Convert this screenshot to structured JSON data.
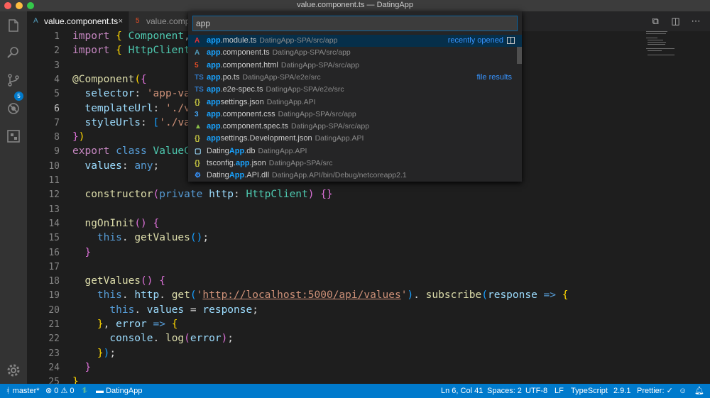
{
  "window": {
    "title": "value.component.ts — DatingApp"
  },
  "activity_bar": {
    "icons": [
      "files-icon",
      "search-icon",
      "source-control-icon",
      "debug-icon",
      "extensions-icon",
      "gear-icon"
    ],
    "scm_badge": "5"
  },
  "tabs": [
    {
      "label": "value.component.ts",
      "active": true,
      "icon": "angular-icon",
      "close": "×"
    },
    {
      "label": "value.compo",
      "active": false,
      "icon": "html-icon"
    }
  ],
  "quick_open": {
    "query": "app",
    "items": [
      {
        "match": "app",
        "rest": ".module.ts",
        "path": "DatingApp-SPA/src/app",
        "icon": "angular-red-icon",
        "tag": "recently opened"
      },
      {
        "match": "app",
        "rest": ".component.ts",
        "path": "DatingApp-SPA/src/app",
        "icon": "angular-blue-icon",
        "tag": ""
      },
      {
        "match": "app",
        "rest": ".component.html",
        "path": "DatingApp-SPA/src/app",
        "icon": "html-icon",
        "tag": ""
      },
      {
        "match": "app",
        "rest": ".po.ts",
        "path": "DatingApp-SPA/e2e/src",
        "icon": "ts-icon",
        "tag": "file results"
      },
      {
        "match": "app",
        "rest": ".e2e-spec.ts",
        "path": "DatingApp-SPA/e2e/src",
        "icon": "ts-icon",
        "tag": ""
      },
      {
        "match": "app",
        "rest": "settings.json",
        "path": "DatingApp.API",
        "icon": "json-icon",
        "tag": ""
      },
      {
        "match": "app",
        "rest": ".component.css",
        "path": "DatingApp-SPA/src/app",
        "icon": "css-icon",
        "tag": ""
      },
      {
        "match": "app",
        "rest": ".component.spec.ts",
        "path": "DatingApp-SPA/src/app",
        "icon": "spec-icon",
        "tag": ""
      },
      {
        "match": "app",
        "rest": "settings.Development.json",
        "path": "DatingApp.API",
        "icon": "json-icon",
        "tag": ""
      },
      {
        "pre": "Dating",
        "match": "App",
        "rest": ".db",
        "path": "DatingApp.API",
        "icon": "file-icon",
        "tag": ""
      },
      {
        "pre": "tsconfig.",
        "match": "app",
        "rest": ".json",
        "path": "DatingApp-SPA/src",
        "icon": "json-icon",
        "tag": ""
      },
      {
        "pre": "Dating",
        "match": "App",
        "rest": ".API.dll",
        "path": "DatingApp.API/bin/Debug/netcoreapp2.1",
        "icon": "gear-file-icon",
        "tag": ""
      }
    ]
  },
  "editor": {
    "line_numbers": [
      "1",
      "2",
      "3",
      "4",
      "5",
      "6",
      "7",
      "8",
      "9",
      "10",
      "11",
      "12",
      "13",
      "14",
      "15",
      "16",
      "17",
      "18",
      "19",
      "20",
      "21",
      "22",
      "23",
      "24",
      "25"
    ],
    "current_line": "6",
    "lines": [
      [
        [
          "kw",
          "import "
        ],
        [
          "br1",
          "{ "
        ],
        [
          "ty",
          "Component"
        ],
        [
          "",
          ","
        ],
        [
          "br2",
          "("
        ]
      ],
      [
        [
          "kw",
          "import "
        ],
        [
          "br1",
          "{ "
        ],
        [
          "ty",
          "HttpClient "
        ],
        [
          "br1",
          "}"
        ]
      ],
      [],
      [
        [
          "deco",
          "@Component"
        ],
        [
          "br1",
          "("
        ],
        [
          "br2",
          "{"
        ]
      ],
      [
        [
          "",
          "  "
        ],
        [
          "prop",
          "selector"
        ],
        [
          "",
          ": "
        ],
        [
          "str",
          "'app-valu"
        ]
      ],
      [
        [
          "",
          "  "
        ],
        [
          "prop",
          "templateUrl"
        ],
        [
          "",
          ": "
        ],
        [
          "str",
          "'./val"
        ]
      ],
      [
        [
          "",
          "  "
        ],
        [
          "prop",
          "styleUrls"
        ],
        [
          "",
          ": "
        ],
        [
          "br3",
          "["
        ],
        [
          "str",
          "'./valu"
        ]
      ],
      [
        [
          "br2",
          "}"
        ],
        [
          "br1",
          ")"
        ]
      ],
      [
        [
          "kw",
          "export "
        ],
        [
          "kw2",
          "class "
        ],
        [
          "ty",
          "ValueCom"
        ]
      ],
      [
        [
          "",
          "  "
        ],
        [
          "prop",
          "values"
        ],
        [
          "",
          ": "
        ],
        [
          "kw2",
          "any"
        ],
        [
          "",
          ";"
        ]
      ],
      [],
      [
        [
          "",
          "  "
        ],
        [
          "fn",
          "constructor"
        ],
        [
          "br2",
          "("
        ],
        [
          "kw2",
          "private "
        ],
        [
          "prop",
          "http"
        ],
        [
          "",
          ": "
        ],
        [
          "ty",
          "HttpClient"
        ],
        [
          "br2",
          ")"
        ],
        [
          "",
          ""
        ],
        [
          "br2",
          " {}"
        ]
      ],
      [],
      [
        [
          "",
          "  "
        ],
        [
          "fn",
          "ngOnInit"
        ],
        [
          "br2",
          "() {"
        ]
      ],
      [
        [
          "",
          "    "
        ],
        [
          "kw2",
          "this"
        ],
        [
          "",
          ". "
        ],
        [
          "fn",
          "getValues"
        ],
        [
          "br3",
          "()"
        ],
        [
          "",
          ";"
        ]
      ],
      [
        [
          "",
          "  "
        ],
        [
          "br2",
          "}"
        ]
      ],
      [],
      [
        [
          "",
          "  "
        ],
        [
          "fn",
          "getValues"
        ],
        [
          "br2",
          "() {"
        ]
      ],
      [
        [
          "",
          "    "
        ],
        [
          "kw2",
          "this"
        ],
        [
          "",
          ". "
        ],
        [
          "prop",
          "http"
        ],
        [
          "",
          ". "
        ],
        [
          "fn",
          "get"
        ],
        [
          "br3",
          "("
        ],
        [
          "str",
          "'"
        ],
        [
          "url",
          "http://localhost:5000/api/values"
        ],
        [
          "str",
          "'"
        ],
        [
          "br3",
          ")"
        ],
        [
          "",
          ". "
        ],
        [
          "fn",
          "subscribe"
        ],
        [
          "br3",
          "("
        ],
        [
          "prop",
          "response"
        ],
        [
          "kw2",
          " => "
        ],
        [
          "br1",
          "{"
        ]
      ],
      [
        [
          "",
          "      "
        ],
        [
          "kw2",
          "this"
        ],
        [
          "",
          ". "
        ],
        [
          "prop",
          "values"
        ],
        [
          "",
          " = "
        ],
        [
          "prop",
          "response"
        ],
        [
          "",
          ";"
        ]
      ],
      [
        [
          "",
          "    "
        ],
        [
          "br1",
          "}"
        ],
        [
          "",
          ", "
        ],
        [
          "prop",
          "error"
        ],
        [
          "kw2",
          " => "
        ],
        [
          "br1",
          "{"
        ]
      ],
      [
        [
          "",
          "      "
        ],
        [
          "prop",
          "console"
        ],
        [
          "",
          ". "
        ],
        [
          "fn",
          "log"
        ],
        [
          "br2",
          "("
        ],
        [
          "prop",
          "error"
        ],
        [
          "br2",
          ")"
        ],
        [
          "",
          ";"
        ]
      ],
      [
        [
          "",
          "    "
        ],
        [
          "br1",
          "}"
        ],
        [
          "br3",
          ")"
        ],
        [
          "",
          ";"
        ]
      ],
      [
        [
          "",
          "  "
        ],
        [
          "br2",
          "}"
        ]
      ],
      [
        [
          "br1",
          "}"
        ]
      ]
    ]
  },
  "statusbar": {
    "branch": "master*",
    "errors": "0",
    "warnings": "0",
    "folder": "DatingApp",
    "position": "Ln 6, Col 41",
    "spaces": "Spaces: 2",
    "encoding": "UTF-8",
    "eol": "LF",
    "language": "TypeScript",
    "ts_version": "2.9.1",
    "prettier": "Prettier: ✓"
  }
}
